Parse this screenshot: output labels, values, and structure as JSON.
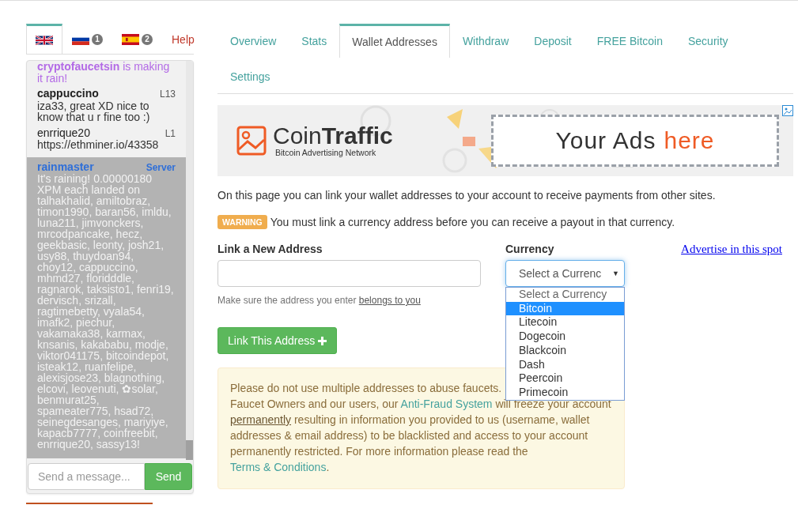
{
  "language_tabs": [
    {
      "kind": "uk-flag",
      "selected": true
    },
    {
      "kind": "ru-flag",
      "badge": "1",
      "selected": false
    },
    {
      "kind": "es-flag",
      "badge": "2",
      "selected": false
    },
    {
      "kind": "text",
      "label": "Help",
      "selected": false
    }
  ],
  "chat": {
    "messages": [
      {
        "kind": "rain",
        "text": "**cryptofaucetsin** is making it rain!"
      },
      {
        "kind": "user",
        "user": "cappuccino",
        "name_bold": true,
        "rank": "L13",
        "text": "iza33, great XD nice to know that u r fine too :)"
      },
      {
        "kind": "user",
        "user": "enrrique20",
        "name_bold": false,
        "rank": "L1",
        "text": "https://ethminer.io/43358"
      },
      {
        "kind": "server",
        "user": "rainmaster",
        "rank": "Server",
        "text": "It's raining! 0.00000180 XPM each landed on talhakhalid, amiltobraz, timon1990, baran56, imldu, luna211, jimvonckers, mrcodpancake, hecz, geekbasic, leonty, josh21, usy88, thuydoan94, choy12, cappuccino, mhmd27, floridddle, ragnarok, taksisto1, fenri19, dervisch, srizall, ragtimebetty, vyala54, imafk2, piechur, vakamaka38, karmax, knsanis, kakababu, modje, viktor041175, bitcoindepot, isteak12, ruanfelipe, alexisjose23, blagnothing, elcovi, leovenuti, ✿solar, benmurat25, spameater775, hsad72, seinegdesanges, mariyiye, kapacb7777, coinfreebit, enrrique20, sassy13!"
      }
    ],
    "input": {
      "placeholder": "Send a message..."
    },
    "send": "Send"
  },
  "tabs": [
    {
      "label": "Overview",
      "selected": false
    },
    {
      "label": "Stats",
      "selected": false
    },
    {
      "label": "Wallet Addresses",
      "selected": true
    },
    {
      "label": "Withdraw",
      "selected": false
    },
    {
      "label": "Deposit",
      "selected": false
    },
    {
      "label": "FREE Bitcoin",
      "selected": false
    },
    {
      "label": "Security",
      "selected": false
    },
    {
      "label": "Settings",
      "selected": false
    }
  ],
  "banner": {
    "brand": "Coin**Traffic**",
    "tagline": "Bitcoin Advertising Network",
    "ad_text": "Your Ads",
    "ad_highlight": "here"
  },
  "intro": "On this page you can link your wallet addresses to your account to receive payments from other sites.",
  "warning": {
    "badge": "WARNING",
    "text": "You must link a currency address before you can receive a payout in that currency."
  },
  "form": {
    "address_label": "Link a New Address",
    "help_text": "Make sure the address you enter ",
    "help_link": "belongs to you",
    "currency_label": "Currency",
    "select_value": "Select a Currenc",
    "select_caret": "▼",
    "options": [
      {
        "label": "Select a Currency",
        "selected": false
      },
      {
        "label": "Bitcoin",
        "selected": true
      },
      {
        "label": "Litecoin",
        "selected": false
      },
      {
        "label": "Dogecoin",
        "selected": false
      },
      {
        "label": "Blackcoin",
        "selected": false
      },
      {
        "label": "Dash",
        "selected": false
      },
      {
        "label": "Peercoin",
        "selected": false
      },
      {
        "label": "Primecoin",
        "selected": false
      }
    ],
    "button": "Link This Address"
  },
  "advertise_link": "Advertise in this spot",
  "notice": {
    "first_line": "Please do not use multiple addresses to abuse faucets.",
    "segments": [
      {
        "kind": "text",
        "text": "Faucet Owners and our users, our "
      },
      {
        "kind": "link",
        "text": "Anti-Fraud System"
      },
      {
        "kind": "text",
        "text": " will freeze your account "
      },
      {
        "kind": "underline",
        "text": "permanently"
      },
      {
        "kind": "text",
        "text": " resulting in information you provided to us (username, wallet addresses & email address) to be blacklisted and access to your account permanently restricted. For more information please read the "
      },
      {
        "kind": "link",
        "text": "Terms & Conditions"
      },
      {
        "kind": "text",
        "text": "."
      }
    ]
  }
}
